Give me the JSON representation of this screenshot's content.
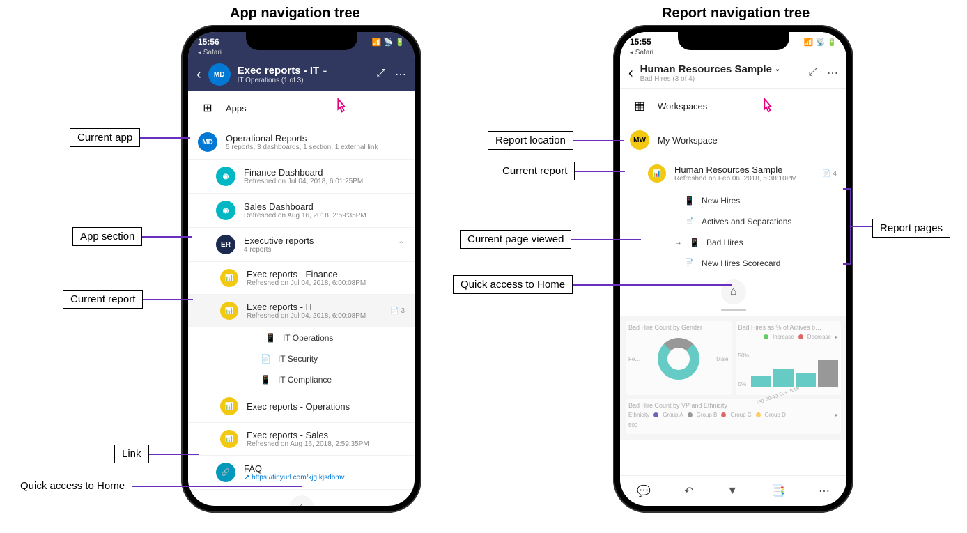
{
  "titles": {
    "left": "App navigation tree",
    "right": "Report navigation tree"
  },
  "left_phone": {
    "status": {
      "time": "15:56",
      "safari": "◂ Safari"
    },
    "header": {
      "avatar": "MD",
      "title": "Exec reports - IT",
      "sub": "IT Operations (1 of 3)"
    },
    "section_apps": "Apps",
    "op_reports": {
      "avatar": "MD",
      "title": "Operational Reports",
      "sub": "5 reports, 3 dashboards, 1 section, 1 external link"
    },
    "finance": {
      "title": "Finance Dashboard",
      "sub": "Refreshed on Jul 04, 2018, 6:01:25PM"
    },
    "sales": {
      "title": "Sales Dashboard",
      "sub": "Refreshed on Aug 16, 2018, 2:59:35PM"
    },
    "exec": {
      "avatar": "ER",
      "title": "Executive reports",
      "sub": "4 reports"
    },
    "exec_fin": {
      "title": "Exec reports - Finance",
      "sub": "Refreshed on Jul 04, 2018, 6:00:08PM"
    },
    "exec_it": {
      "title": "Exec reports - IT",
      "sub": "Refreshed on Jul 04, 2018, 6:00:08PM",
      "count": "3"
    },
    "pages": {
      "p1": "IT Operations",
      "p2": "IT Security",
      "p3": "IT Compliance"
    },
    "exec_ops": {
      "title": "Exec reports - Operations"
    },
    "exec_sales": {
      "title": "Exec reports - Sales",
      "sub": "Refreshed on Aug 16, 2018, 2:59:35PM"
    },
    "faq": {
      "title": "FAQ",
      "url": "https://tinyurl.com/kjg;kjsdbmv"
    }
  },
  "right_phone": {
    "status": {
      "time": "15:55",
      "safari": "◂ Safari"
    },
    "header": {
      "title": "Human Resources Sample",
      "sub": "Bad Hires (3 of 4)"
    },
    "section_ws": "Workspaces",
    "my_ws": {
      "avatar": "MW",
      "title": "My Workspace"
    },
    "hr": {
      "title": "Human Resources Sample",
      "sub": "Refreshed on Feb 06, 2018, 5:38:10PM",
      "count": "4"
    },
    "pages": {
      "p1": "New Hires",
      "p2": "Actives and Separations",
      "p3": "Bad Hires",
      "p4": "New Hires Scorecard"
    },
    "charts": {
      "c1": "Bad Hire Count by Gender",
      "c2": "Bad Hires as % of Actives b…",
      "legend_inc": "Increase",
      "legend_dec": "Decrease",
      "fe": "Fe…",
      "male": "Male",
      "y50": "50%",
      "y0": "0%",
      "x1": "<30",
      "x2": "30-49",
      "x3": "50+",
      "x4": "Total",
      "c3": "Bad Hire Count by VP and Ethnicity",
      "eth": "Ethnicity",
      "ga": "Group A",
      "gb": "Group B",
      "gc": "Group C",
      "gd": "Group D",
      "v500": "500"
    }
  },
  "callouts": {
    "current_app": "Current app",
    "app_section": "App section",
    "current_report": "Current report",
    "link": "Link",
    "home": "Quick access to Home",
    "report_loc": "Report location",
    "current_report2": "Current report",
    "current_page": "Current page viewed",
    "home2": "Quick access to Home",
    "report_pages": "Report pages"
  }
}
